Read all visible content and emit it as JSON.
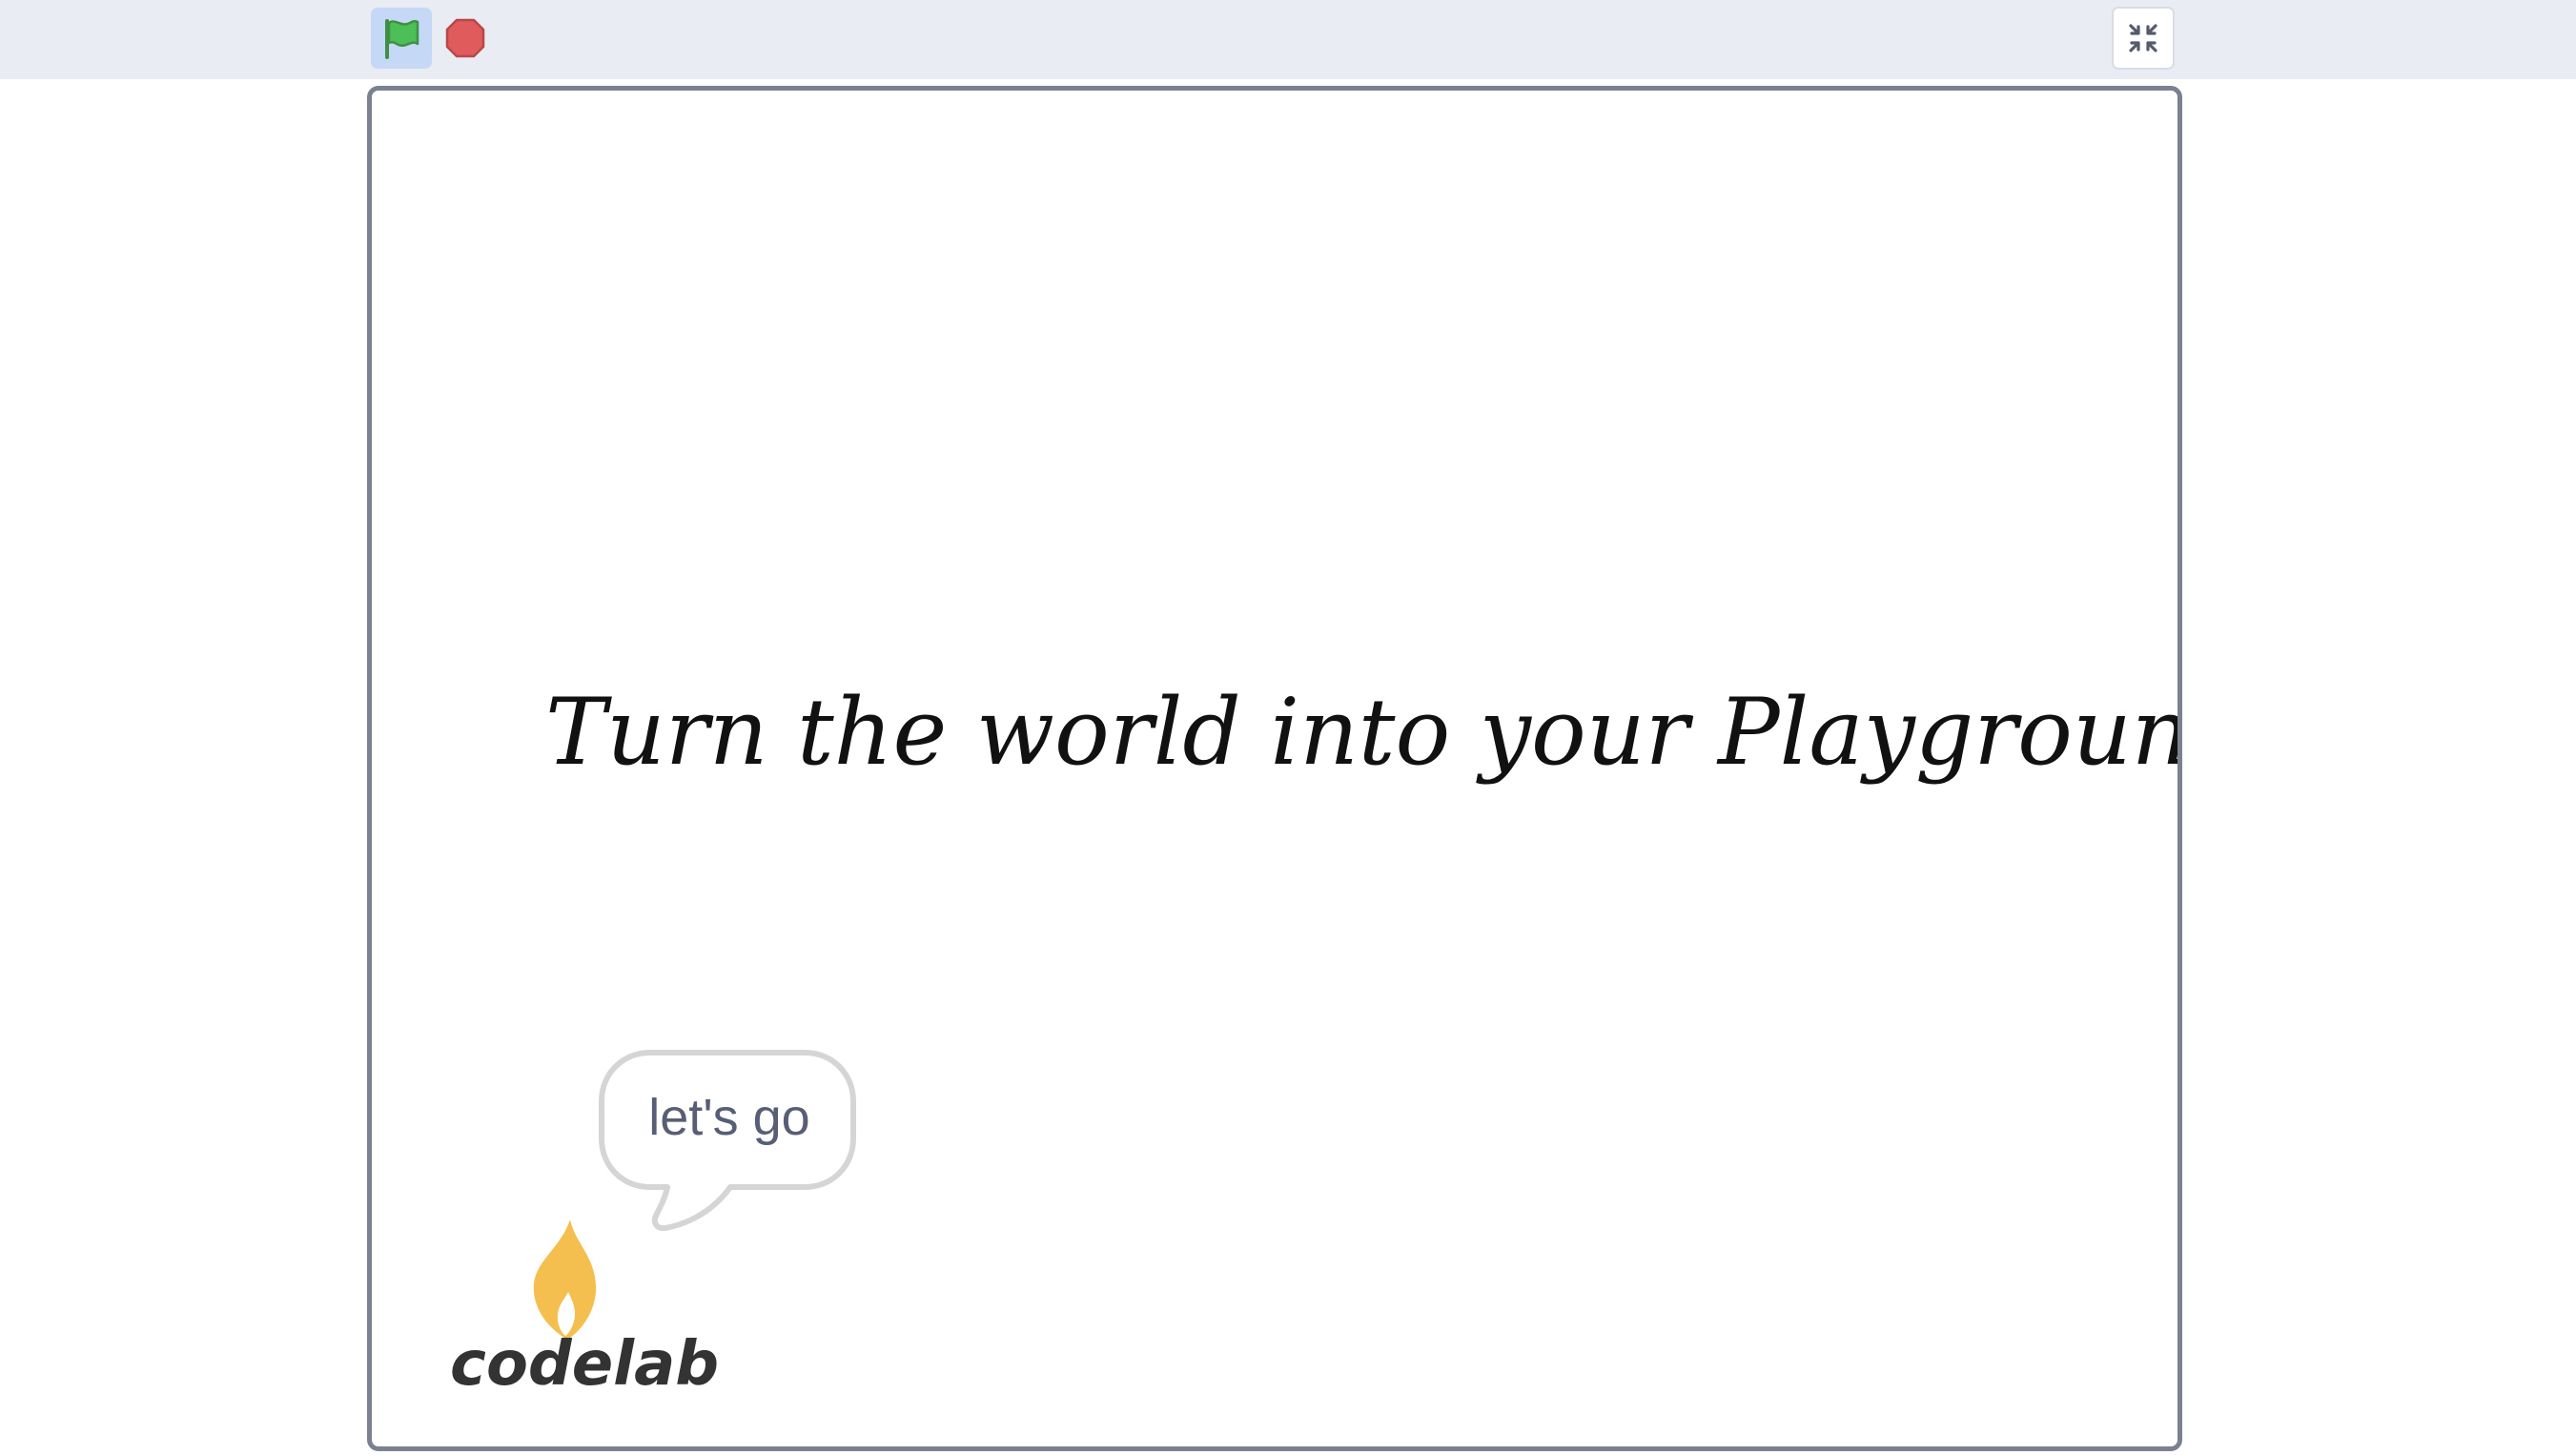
{
  "toolbar": {
    "green_flag_icon": "green-flag-icon",
    "stop_icon": "stop-icon",
    "fullscreen_exit_icon": "fullscreen-exit-icon",
    "colors": {
      "toolbar_background": "#e9edf3",
      "flag_active_background": "#c5d8f6",
      "flag_green": "#4cbf56",
      "stop_red": "#e05c5c"
    }
  },
  "stage": {
    "headline": "Turn the world  into your Playground",
    "speech_text": "let's go",
    "logo_text": "codelab",
    "colors": {
      "stage_border": "#7b8191",
      "speech_border": "#d5d5d5",
      "speech_text": "#575e75",
      "flame": "#f4bf4f",
      "logo_text": "#333333"
    }
  }
}
